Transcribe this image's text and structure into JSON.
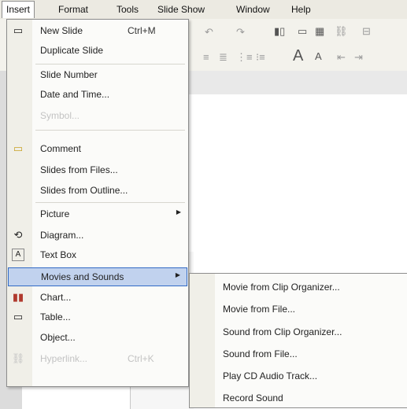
{
  "menubar": {
    "items": [
      {
        "label": "Insert",
        "active": true
      },
      {
        "label": "Format"
      },
      {
        "label": "Tools"
      },
      {
        "label": "Slide Show"
      },
      {
        "label": "Window"
      },
      {
        "label": "Help"
      }
    ]
  },
  "insert_menu": {
    "items": [
      {
        "label": "New Slide",
        "shortcut": "Ctrl+M",
        "icon": "new-slide-icon"
      },
      {
        "label": "Duplicate Slide"
      },
      {
        "label": "Slide Number"
      },
      {
        "label": "Date and Time..."
      },
      {
        "label": "Symbol...",
        "disabled": true
      },
      {
        "label": "Comment",
        "icon": "comment-icon"
      },
      {
        "label": "Slides from Files..."
      },
      {
        "label": "Slides from Outline..."
      },
      {
        "label": "Picture",
        "submenu": true
      },
      {
        "label": "Diagram...",
        "icon": "diagram-icon"
      },
      {
        "label": "Text Box",
        "icon": "text-box-icon"
      },
      {
        "label": "Movies and Sounds",
        "submenu": true,
        "highlighted": true
      },
      {
        "label": "Chart...",
        "icon": "chart-icon"
      },
      {
        "label": "Table...",
        "icon": "table-icon"
      },
      {
        "label": "Object..."
      },
      {
        "label": "Hyperlink...",
        "shortcut": "Ctrl+K",
        "disabled": true,
        "icon": "hyperlink-icon"
      }
    ]
  },
  "movies_sounds_submenu": {
    "items": [
      {
        "label": "Movie from Clip Organizer..."
      },
      {
        "label": "Movie from File..."
      },
      {
        "label": "Sound from Clip Organizer..."
      },
      {
        "label": "Sound from File..."
      },
      {
        "label": "Play CD Audio Track..."
      },
      {
        "label": "Record Sound"
      }
    ]
  },
  "colors": {
    "highlight": "#c1d2ee",
    "highlight_border": "#316ac5",
    "menubar": "#eceae2"
  }
}
